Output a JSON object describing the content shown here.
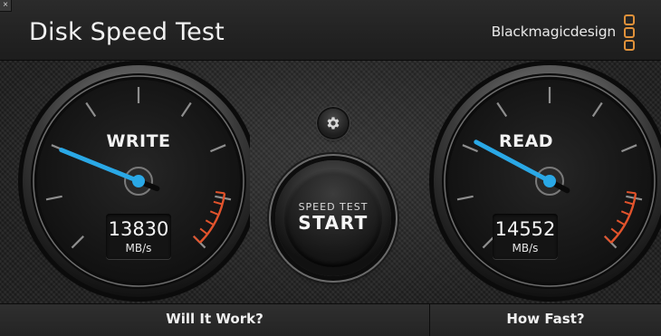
{
  "window": {
    "close_label": "×"
  },
  "header": {
    "title": "Disk Speed Test",
    "brand": "Blackmagicdesign"
  },
  "gauges": {
    "write": {
      "label": "WRITE",
      "value": "13830",
      "unit": "MB/s"
    },
    "read": {
      "label": "READ",
      "value": "14552",
      "unit": "MB/s"
    }
  },
  "start_button": {
    "top_label": "SPEED TEST",
    "main_label": "START"
  },
  "tabs": {
    "left": "Will It Work?",
    "right": "How Fast?"
  },
  "colors": {
    "needle": "#2aa8e6",
    "redline": "#e2532c",
    "brand_logo": "#e0913a"
  },
  "icons": {
    "settings": "gear-icon",
    "close": "close-icon"
  }
}
